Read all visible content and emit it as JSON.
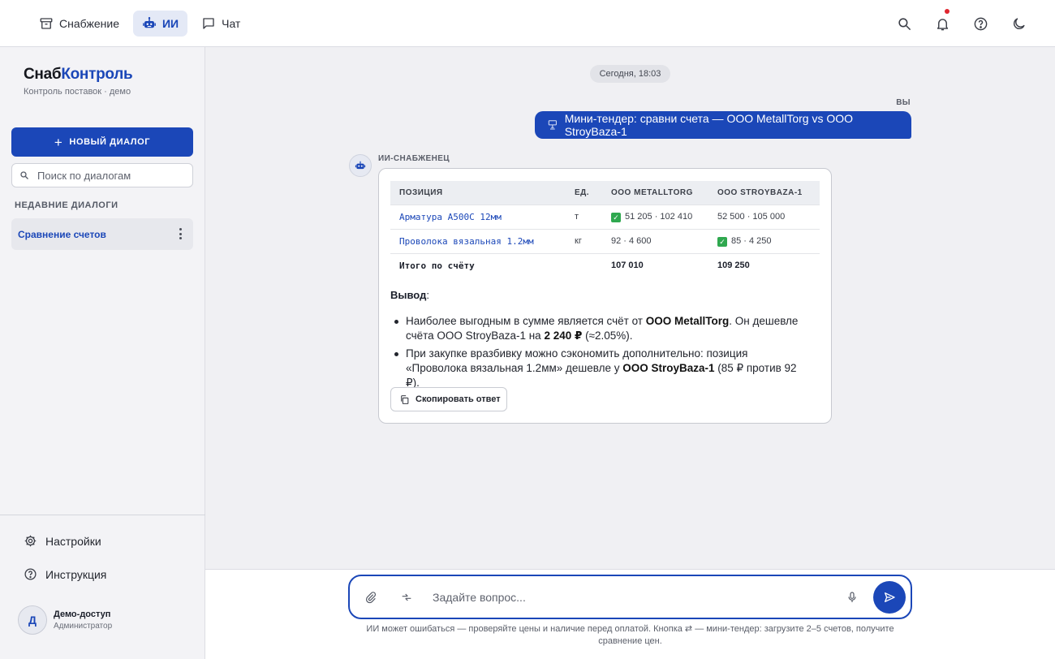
{
  "nav": {
    "tabs": [
      {
        "label": "Снабжение",
        "icon": "archive-icon",
        "active": false
      },
      {
        "label": "ИИ",
        "icon": "robot-icon",
        "active": true
      },
      {
        "label": "Чат",
        "icon": "chat-icon",
        "active": false
      }
    ],
    "icons": [
      "search-icon",
      "bell-icon",
      "help-icon",
      "moon-icon"
    ],
    "has_notification": true
  },
  "sidebar": {
    "brand_part1": "Снаб",
    "brand_part2": "Контроль",
    "subtitle": "Контроль поставок · демо",
    "new_dialog_label": "НОВЫЙ ДИАЛОГ",
    "search_placeholder": "Поиск по диалогам",
    "recent_label": "НЕДАВНИЕ ДИАЛОГИ",
    "recent_dialogs": [
      {
        "label": "Сравнение счетов",
        "active": true
      }
    ],
    "settings_label": "Настройки",
    "help_label": "Инструкция",
    "user": {
      "initial": "Д",
      "name": "Демо-доступ",
      "role": "Администратор"
    }
  },
  "chat": {
    "date": "Сегодня, 18:03",
    "user_label": "ВЫ",
    "user_message": "Мини-тендер: сравни счета — ООО MetallTorg vs ООО StroyBaza-1",
    "bot_label": "ИИ-СНАБЖЕНЕЦ",
    "table": {
      "headers": [
        "ПОЗИЦИЯ",
        "ЕД.",
        "ООО METALLTORG",
        "ООО STROYBAZA-1"
      ],
      "rows": [
        {
          "position": "Арматура А500С 12мм",
          "unit": "т",
          "metalltorg": "51 205 · 102 410",
          "stroybaza": "52 500 · 105 000",
          "best": "metalltorg"
        },
        {
          "position": "Проволока вязальная 1.2мм",
          "unit": "кг",
          "metalltorg": "92 · 4 600",
          "stroybaza": "85 · 4 250",
          "best": "stroybaza"
        }
      ],
      "total": {
        "position": "Итого по счёту",
        "unit": "",
        "metalltorg": "107 010",
        "stroybaza": "109 250"
      }
    },
    "conclusion_label": "Вывод",
    "bullets": [
      {
        "t1": "Наиболее выгодным в сумме является счёт от ",
        "b1": "ООО MetallTorg",
        "t2": ". Он дешевле счёта ООО StroyBaza-1 на ",
        "b2": "2 240 ₽",
        "t3": " (≈2.05%)."
      },
      {
        "t1": "При закупке вразбивку можно сэкономить дополнительно: позиция «Проволока вязальная 1.2мм» дешевле у ",
        "b1": "ООО StroyBaza-1",
        "t2": " (85 ₽ против 92 ₽)."
      }
    ],
    "copy_label": "Скопировать ответ"
  },
  "composer": {
    "placeholder": "Задайте вопрос...",
    "disclaimer": "ИИ может ошибаться — проверяйте цены и наличие перед оплатой. Кнопка ⇄ — мини-тендер: загрузите 2–5 счетов, получите сравнение цен."
  },
  "colors": {
    "accent": "#1b47b8",
    "ok": "#2fa84f",
    "notification": "#e0262f"
  }
}
